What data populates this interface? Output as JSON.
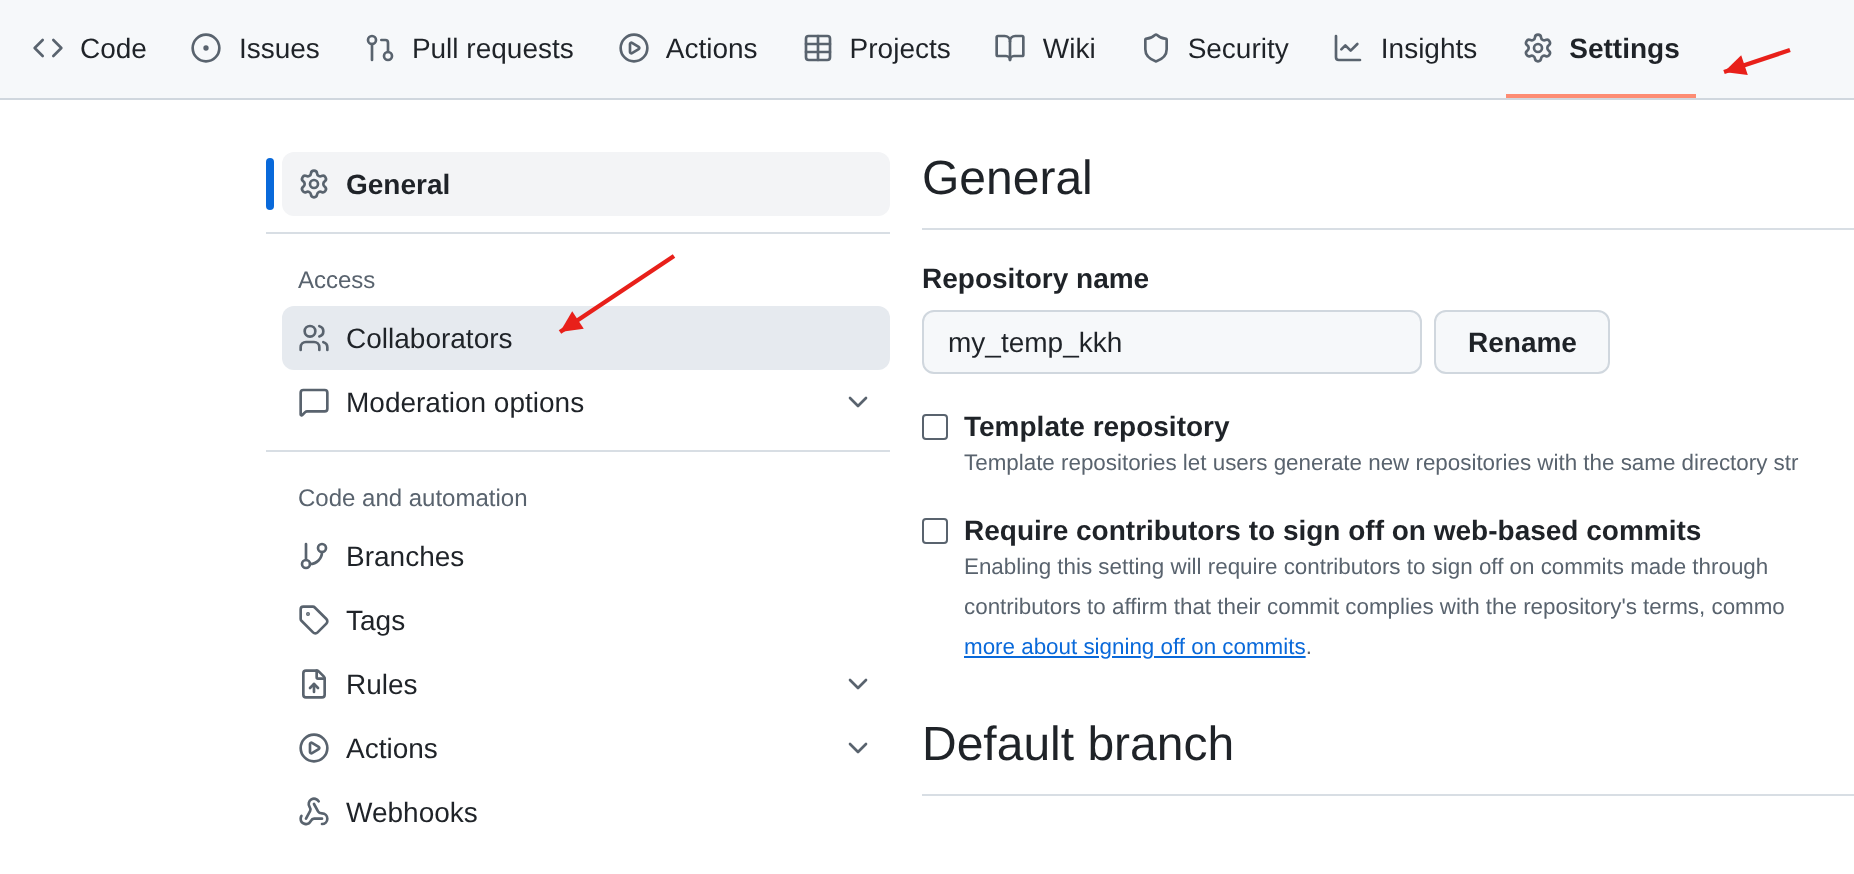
{
  "tabs": [
    {
      "label": "Code",
      "selected": false
    },
    {
      "label": "Issues",
      "selected": false
    },
    {
      "label": "Pull requests",
      "selected": false
    },
    {
      "label": "Actions",
      "selected": false
    },
    {
      "label": "Projects",
      "selected": false
    },
    {
      "label": "Wiki",
      "selected": false
    },
    {
      "label": "Security",
      "selected": false
    },
    {
      "label": "Insights",
      "selected": false
    },
    {
      "label": "Settings",
      "selected": true
    }
  ],
  "sidebar": {
    "sections": [
      {
        "items": [
          {
            "label": "General",
            "selected": true,
            "hovered": false,
            "expandable": false
          }
        ]
      },
      {
        "heading": "Access",
        "items": [
          {
            "label": "Collaborators",
            "selected": false,
            "hovered": true,
            "expandable": false
          },
          {
            "label": "Moderation options",
            "selected": false,
            "hovered": false,
            "expandable": true
          }
        ]
      },
      {
        "heading": "Code and automation",
        "items": [
          {
            "label": "Branches",
            "selected": false,
            "hovered": false,
            "expandable": false
          },
          {
            "label": "Tags",
            "selected": false,
            "hovered": false,
            "expandable": false
          },
          {
            "label": "Rules",
            "selected": false,
            "hovered": false,
            "expandable": true
          },
          {
            "label": "Actions",
            "selected": false,
            "hovered": false,
            "expandable": true
          },
          {
            "label": "Webhooks",
            "selected": false,
            "hovered": false,
            "expandable": false
          }
        ]
      }
    ]
  },
  "main": {
    "title": "General",
    "repository_name": {
      "label": "Repository name",
      "value": "my_temp_kkh",
      "button": "Rename"
    },
    "options": [
      {
        "label": "Template repository",
        "checked": false,
        "lines": [
          "Template repositories let users generate new repositories with the same directory str"
        ]
      },
      {
        "label": "Require contributors to sign off on web-based commits",
        "checked": false,
        "lines": [
          "Enabling this setting will require contributors to sign off on commits made through",
          "contributors to affirm that their commit complies with the repository's terms, commo"
        ],
        "link": "more about signing off on commits",
        "after_link": "."
      }
    ],
    "next_heading": "Default branch"
  }
}
